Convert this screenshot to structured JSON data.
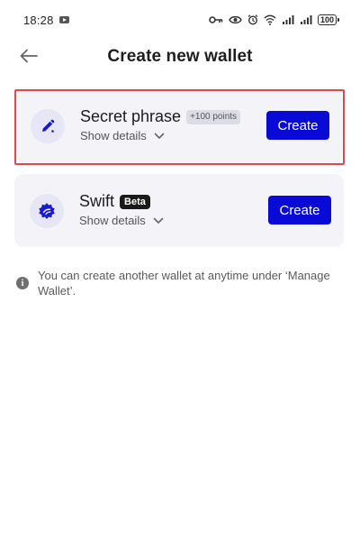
{
  "status_bar": {
    "time": "18:28",
    "battery": "100"
  },
  "header": {
    "title": "Create new wallet"
  },
  "wallets": [
    {
      "title": "Secret phrase",
      "badge": "+100 points",
      "details_label": "Show details",
      "create_label": "Create",
      "icon": "pen-icon"
    },
    {
      "title": "Swift",
      "badge": "Beta",
      "details_label": "Show details",
      "create_label": "Create",
      "icon": "swift-badge-icon"
    }
  ],
  "info": {
    "text": "You can create another wallet at anytime under ‘Manage Wallet’."
  },
  "colors": {
    "primary_button": "#0a0ad6",
    "card_background": "#f4f4f8",
    "highlight_frame": "#e0484d",
    "icon_accent": "#1a1acc"
  }
}
